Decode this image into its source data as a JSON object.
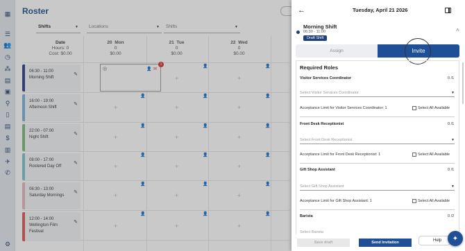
{
  "roster": {
    "title": "Roster",
    "filters": {
      "shifts": "Shifts",
      "locations_placeholder": "Locations",
      "shifts_placeholder": "Shifts"
    },
    "date_column": {
      "label": "Date",
      "hours": "Hours: 0",
      "cost": "Cost: $0.00"
    },
    "days": [
      {
        "num": "20",
        "name": "Mon",
        "hours": "0",
        "cost": "$0.00"
      },
      {
        "num": "21",
        "name": "Tue",
        "hours": "0",
        "cost": "$0.00"
      },
      {
        "num": "22",
        "name": "Wed",
        "hours": "0",
        "cost": "$0.00"
      }
    ],
    "shifts": [
      {
        "time": "06:30 - 11:00",
        "name": "Morning Shift",
        "color": "#2f3f86"
      },
      {
        "time": "16:00 - 19:00",
        "name": "Afternoon Shift",
        "color": "#7bb0dc"
      },
      {
        "time": "22:00 - 07:00",
        "name": "Night Shift",
        "color": "#7cbc7c"
      },
      {
        "time": "08:00 - 17:00",
        "name": "Rostered Day Off",
        "color": "#7fc4cc"
      },
      {
        "time": "06:30 - 13:00",
        "name": "Saturday Mornings",
        "color": "#e7b8c4"
      },
      {
        "time": "12:00 - 14:00",
        "name": "Wellington Film",
        "name2": "Festival",
        "color": "#d95a5a"
      }
    ],
    "badge_count": "1"
  },
  "panel": {
    "date": "Tuesday, April 21 2026",
    "shift_name": "Morning Shift",
    "shift_time": "06:30 - 11:00",
    "status_badge": "Draft Shift",
    "tabs": {
      "assign": "Assign",
      "invite": "Invite"
    },
    "required_roles_title": "Required Roles",
    "roles": [
      {
        "title": "Visitor Services Coordinator",
        "count": "0 /1",
        "placeholder": "Select Visitor Services Coordinator",
        "limit_label": "Acceptance Limit for Visitor Services Coordinator:",
        "limit_value": "1",
        "select_all": "Select All Available"
      },
      {
        "title": "Front Desk Receptionist",
        "count": "0 /1",
        "placeholder": "Select Front Desk Receptionist",
        "limit_label": "Acceptance Limit for Front Desk Receptionist:",
        "limit_value": "1",
        "select_all": "Select All Available"
      },
      {
        "title": "Gift Shop Assistant",
        "count": "0 /1",
        "placeholder": "Select Gift Shop Assistant",
        "limit_label": "Acceptance Limit for Gift Shop Assistant:",
        "limit_value": "1",
        "select_all": "Select All Available"
      },
      {
        "title": "Barista",
        "count": "0 /2",
        "placeholder": "Select Barista"
      }
    ],
    "footer": {
      "save_draft": "Save draft",
      "send_invitation": "Send Invitation",
      "help": "Help"
    }
  },
  "colors": {
    "primary": "#1f4f96",
    "badge": "#1f3f7a",
    "alert": "#d33333"
  }
}
